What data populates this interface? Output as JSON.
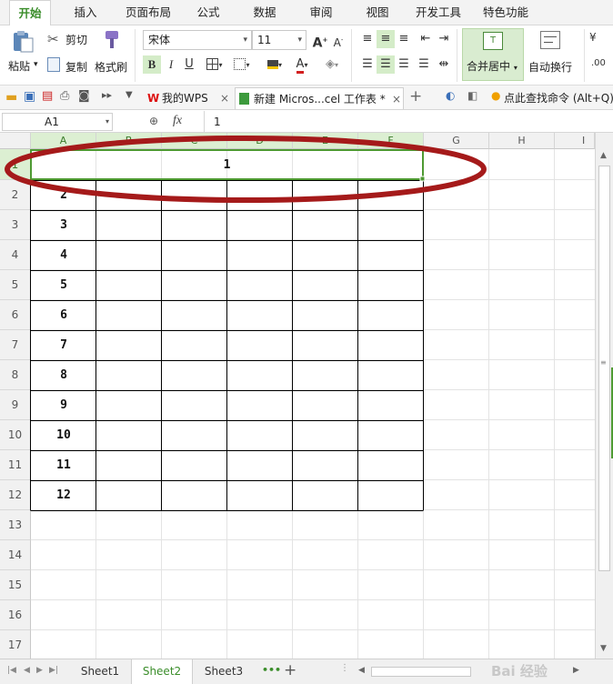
{
  "menu": {
    "tabs": [
      "开始",
      "插入",
      "页面布局",
      "公式",
      "数据",
      "审阅",
      "视图",
      "开发工具",
      "特色功能"
    ],
    "active": "开始"
  },
  "ribbon": {
    "paste": "粘贴",
    "cut": "剪切",
    "copy": "复制",
    "format_painter": "格式刷",
    "font_name": "宋体",
    "font_size": "11",
    "bold": "B",
    "italic": "I",
    "underline": "U",
    "font_color_letter": "A",
    "grow_font": "A",
    "shrink_font": "A",
    "merge_center": "合并居中",
    "wrap_text": "自动换行",
    "number_format_hint": ".00"
  },
  "tabs_bar": {
    "my_wps": "我的WPS",
    "document": "新建 Micros...cel 工作表 *",
    "search_hint": "点此查找命令 (Alt+Q)"
  },
  "formula_bar": {
    "name_box": "A1",
    "fx": "fx",
    "value": "1"
  },
  "grid": {
    "columns": [
      "A",
      "B",
      "C",
      "D",
      "E",
      "F",
      "G",
      "H",
      "I"
    ],
    "rows": [
      "1",
      "2",
      "3",
      "4",
      "5",
      "6",
      "7",
      "8",
      "9",
      "10",
      "11",
      "12",
      "13",
      "14",
      "15",
      "16",
      "17"
    ],
    "merged_value": "1",
    "col_a_values": [
      "2",
      "3",
      "4",
      "5",
      "6",
      "7",
      "8",
      "9",
      "10",
      "11",
      "12"
    ]
  },
  "sheets": {
    "tabs": [
      "Sheet1",
      "Sheet2",
      "Sheet3"
    ],
    "active": "Sheet2"
  },
  "colors": {
    "accent": "#3a8d2a",
    "selection_border": "#4e9a32",
    "annotation_ellipse": "#a51a1a"
  },
  "watermark": "Bai 经验"
}
